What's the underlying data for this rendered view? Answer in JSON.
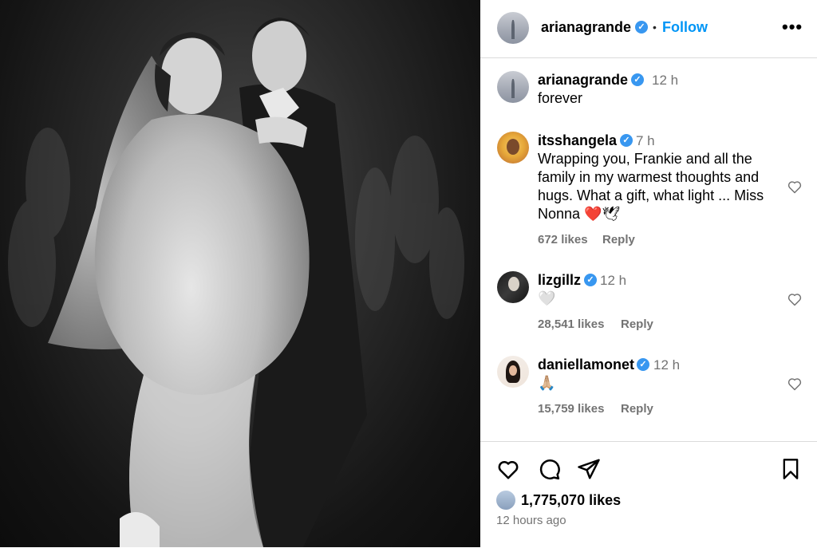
{
  "post": {
    "author": "arianagrande",
    "follow_label": "Follow",
    "more_label": "•••",
    "caption_author": "arianagrande",
    "caption_time": "12 h",
    "caption_text": "forever",
    "likes_count": "1,775,070 likes",
    "posted_ago": "12 hours ago"
  },
  "comments": [
    {
      "user": "itsshangela",
      "time": "7 h",
      "lines": [
        "Wrapping you, Frankie and all the",
        "family in my warmest thoughts and",
        "hugs. What a gift, what light ... Miss",
        "Nonna ❤️🕊"
      ],
      "likes": "672 likes",
      "reply": "Reply"
    },
    {
      "user": "lizgillz",
      "time": "12 h",
      "lines": [
        "🤍"
      ],
      "likes": "28,541 likes",
      "reply": "Reply"
    },
    {
      "user": "daniellamonet",
      "time": "12 h",
      "lines": [
        "🙏🏼"
      ],
      "likes": "15,759 likes",
      "reply": "Reply"
    }
  ],
  "icons": {
    "verified": "verified-badge-icon",
    "like": "heart-icon",
    "comment": "comment-bubble-icon",
    "share": "paper-plane-icon",
    "save": "bookmark-icon"
  },
  "colors": {
    "accent": "#0095f6",
    "verified": "#3897f0",
    "muted": "#737373",
    "divider": "#dbdbdb"
  }
}
